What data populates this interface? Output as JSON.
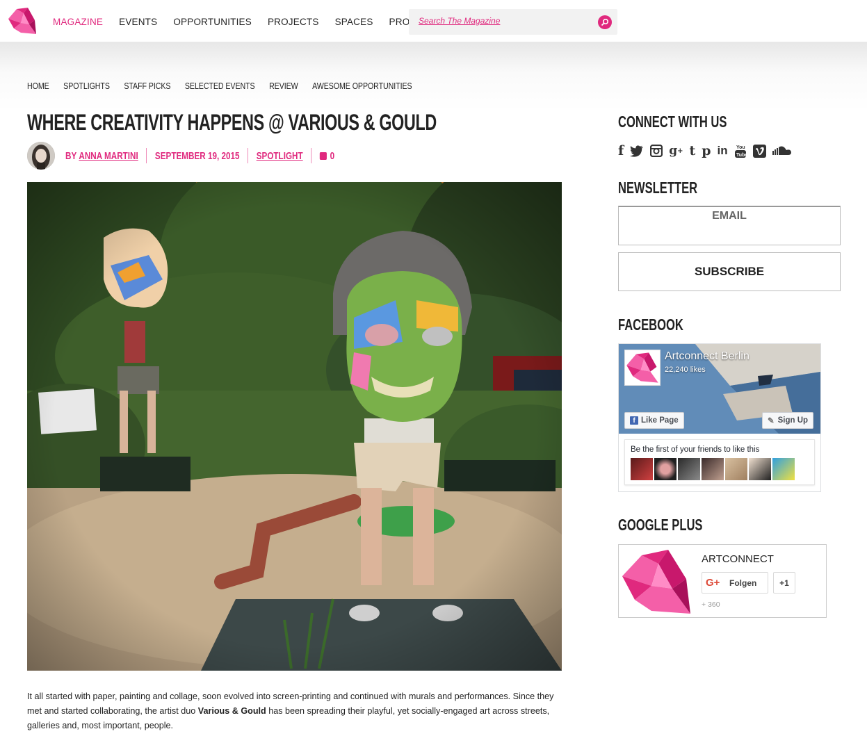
{
  "brand": {
    "accent": "#e0297e"
  },
  "nav": {
    "items": [
      {
        "label": "MAGAZINE",
        "active": true
      },
      {
        "label": "EVENTS"
      },
      {
        "label": "OPPORTUNITIES"
      },
      {
        "label": "PROJECTS"
      },
      {
        "label": "SPACES"
      },
      {
        "label": "PROFILES"
      }
    ],
    "search_placeholder": "Search The Magazine"
  },
  "subnav": {
    "items": [
      "HOME",
      "SPOTLIGHTS",
      "STAFF PICKS",
      "SELECTED EVENTS",
      "REVIEW",
      "AWESOME OPPORTUNITIES"
    ]
  },
  "article": {
    "title": "WHERE CREATIVITY HAPPENS @ VARIOUS & GOULD",
    "by": "BY",
    "author": "ANNA MARTINI",
    "date": "SEPTEMBER 19, 2015",
    "category": "SPOTLIGHT",
    "comments": "0",
    "body_part1": "It all started with paper, painting and collage, soon evolved into screen-printing and continued with murals and performances. Since they met and started collaborating, the artist duo ",
    "body_bold": "Various & Gould",
    "body_part2": " has been spreading their playful, yet socially-engaged art across streets, galleries and, most important, people."
  },
  "sidebar": {
    "connect_title": "CONNECT WITH US",
    "social_icons": [
      "facebook-icon",
      "twitter-icon",
      "instagram-icon",
      "google-plus-icon",
      "tumblr-icon",
      "pinterest-icon",
      "linkedin-icon",
      "youtube-icon",
      "vimeo-icon",
      "soundcloud-icon"
    ],
    "newsletter_title": "NEWSLETTER",
    "email_placeholder": "EMAIL",
    "subscribe_label": "SUBSCRIBE",
    "facebook_title": "FACEBOOK",
    "fb_page_name": "Artconnect Berlin",
    "fb_likes": "22,240 likes",
    "fb_like_label": "Like Page",
    "fb_signup_label": "Sign Up",
    "fb_friends_text": "Be the first of your friends to like this",
    "googleplus_title": "GOOGLE PLUS",
    "gp_name": "ARTCONNECT",
    "gp_follow_label": "Folgen",
    "gp_plus_label": "+1",
    "gp_count": "+ 360"
  }
}
